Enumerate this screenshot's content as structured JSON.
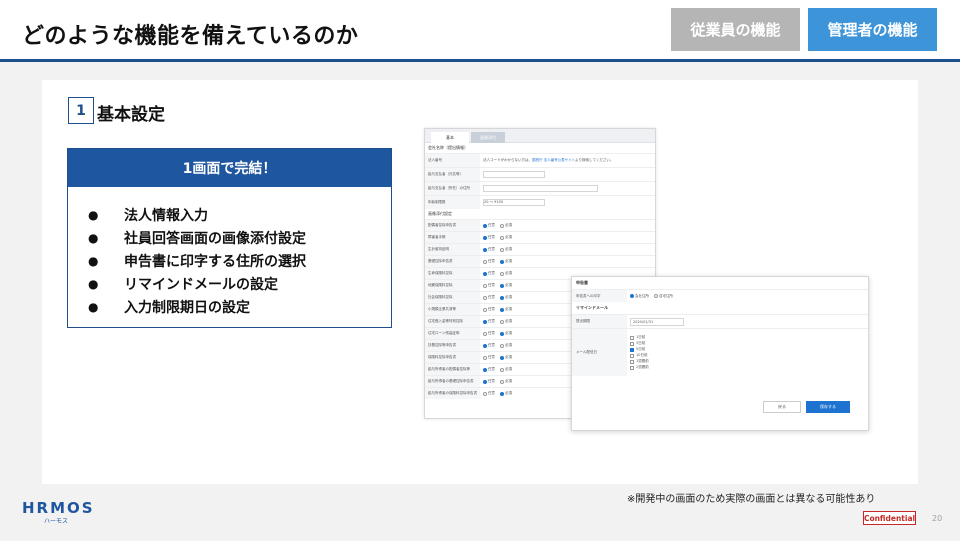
{
  "header": {
    "title": "どのような機能を備えているのか",
    "tabs": [
      "従業員の機能",
      "管理者の機能"
    ]
  },
  "section": {
    "number": "1",
    "title": "基本設定"
  },
  "feature_box": {
    "heading": "1画面で完結！",
    "items": [
      "法人情報入力",
      "社員回答画面の画像添付設定",
      "申告書に印字する住所の選択",
      "リマインドメールの設定",
      "入力制限期日の設定"
    ]
  },
  "screenshot1": {
    "tabs": [
      "基本",
      "画像添付"
    ],
    "section_corp": "会社名称（提出情報）",
    "rows_corp": [
      {
        "label": "法人番号",
        "value": "法人コードがわからない方は、",
        "link": "国税庁 法人番号公表サイト",
        "value_after": "より検索してください。"
      },
      {
        "label": "給与支払者（氏名等）",
        "value": ""
      },
      {
        "label": "給与支払者（所在）の住所",
        "value": ""
      },
      {
        "label": "年齢制限数",
        "value": "20 〜 9100"
      }
    ],
    "section_image": "画像添付設定",
    "rows_image": [
      "配偶者控除申告書",
      "障害者手帳",
      "生計維持証明",
      "基礎控除申告書",
      "生命保険料控除",
      "地震保険料控除",
      "社会保険料控除",
      "小規模企業共済等",
      "住宅借入金等特別控除",
      "住宅ローン残高証明",
      "扶養控除等申告書",
      "保険料控除申告書",
      "給与所得者の配偶者控除等",
      "給与所得者の基礎控除申告書",
      "給与所得者の保険料控除申告書"
    ],
    "radio_labels": [
      "任意",
      "必須"
    ]
  },
  "screenshot2": {
    "section_print": "申告書",
    "row_print_label": "申告書への印字",
    "row_print_options": [
      "会社住所",
      "自宅住所"
    ],
    "section_remind": "リマインドメール",
    "row_date_label": "提出期限",
    "row_date_value": "2020/01/31",
    "row_mail_label": "メール配信日",
    "check_options": [
      "1日前",
      "3日前",
      "5日前",
      "10日前",
      "1週間前",
      "2週間前"
    ],
    "cancel_label": "戻る",
    "save_label": "保存する"
  },
  "footer": {
    "note": "※開発中の画面のため実際の画面とは異なる可能性あり",
    "logo": "HRMOS",
    "logo_sub": "ハーモス",
    "confidential": "Confidential",
    "page_number": "20"
  },
  "colors": {
    "brand": "#1f56a0",
    "admin_tab": "#3d94d8",
    "employee_tab": "#b5b5b5",
    "confidential": "#c62828"
  }
}
